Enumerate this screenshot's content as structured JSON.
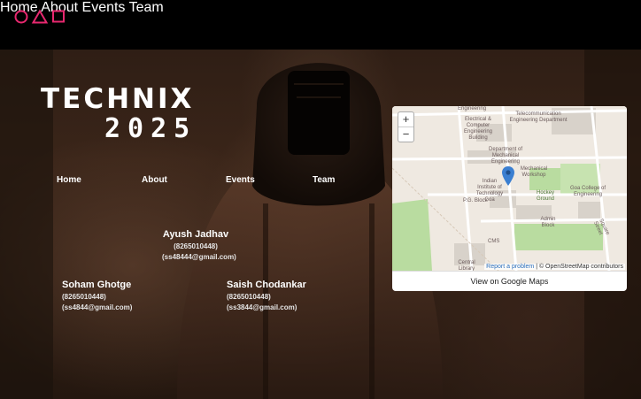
{
  "nav": {
    "home": "Home",
    "about": "About",
    "events": "Events",
    "team": "Team"
  },
  "hero": {
    "title_line1": "TECHNIX",
    "title_line2": "2025"
  },
  "subnav": {
    "home": "Home",
    "about": "About",
    "events": "Events",
    "team": "Team"
  },
  "contacts": [
    {
      "name": "Ayush Jadhav",
      "phone": "(8265010448)",
      "email": "(ss48444@gmail.com)"
    },
    {
      "name": "Soham Ghotge",
      "phone": "(8265010448)",
      "email": "(ss4844@gmail.com)"
    },
    {
      "name": "Saish Chodankar",
      "phone": "(8265010448)",
      "email": "(ss3844@gmail.com)"
    }
  ],
  "map": {
    "zoom_in": "+",
    "zoom_out": "−",
    "report": "Report a problem",
    "attribution": " | © OpenStreetMap contributors",
    "footer": "View on Google Maps",
    "labels": {
      "engineering": "Engineering",
      "telecom": "Telecommunication Engineering Department",
      "electrical": "Electrical & Computer Engineering Building",
      "mech": "Department of Mechanical Engineering",
      "workshop": "Mechanical Workshop",
      "indian": "Indian Institute of Technology Goa",
      "pgblock": "P.G. Block",
      "hockey": "Hockey Ground",
      "gec": "Goa College of Engineering",
      "admin": "Admin Block",
      "cms": "CMS",
      "central": "Central Library",
      "square": "Square Street"
    },
    "pin_color": "#3b7fd1",
    "park_color": "#b9dca0"
  },
  "colors": {
    "logo": "#e8286f",
    "topbar": "#000000"
  }
}
